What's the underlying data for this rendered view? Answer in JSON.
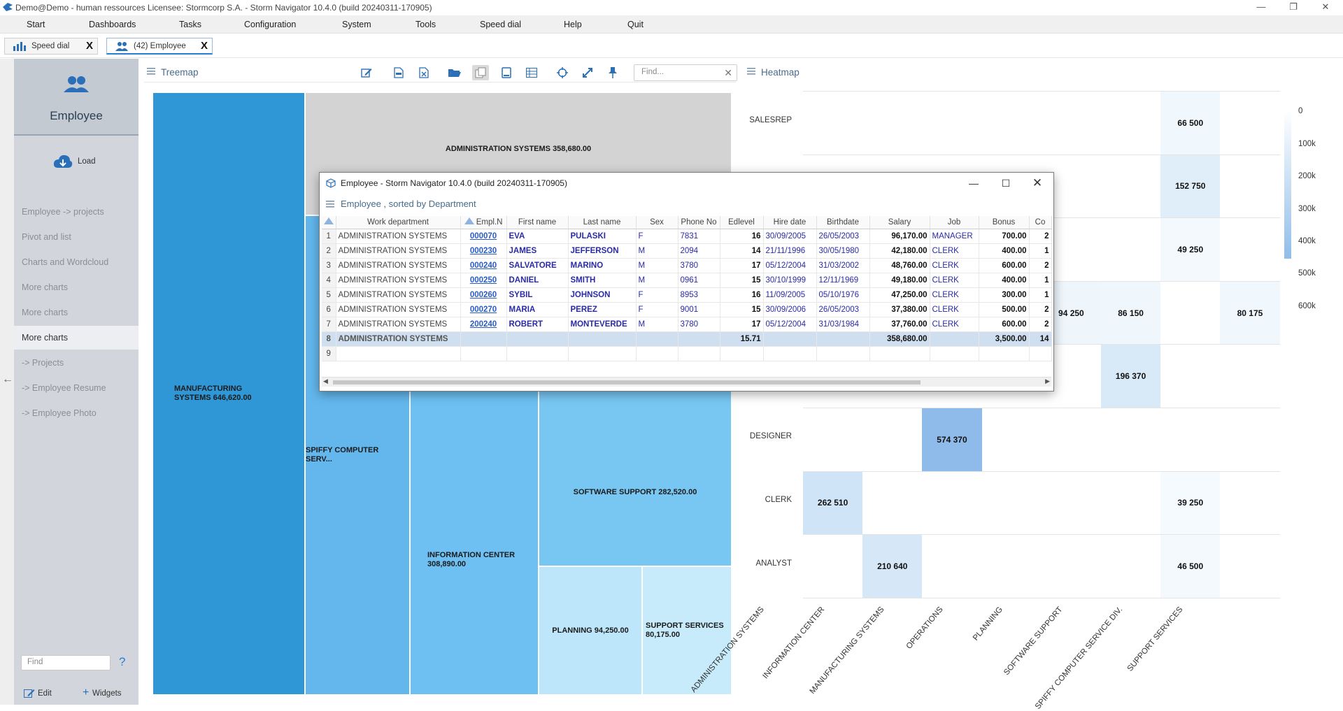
{
  "window": {
    "title": "Demo@Demo - human ressources   Licensee: Stormcorp S.A. -  Storm Navigator 10.4.0 (build 20240311-170905)",
    "controls": [
      "—",
      "❐",
      "✕"
    ]
  },
  "menu": [
    "Start",
    "Dashboards",
    "Tasks",
    "Configuration",
    "System",
    "Tools",
    "Speed dial",
    "Help",
    "Quit"
  ],
  "tabs": [
    {
      "label": "Speed dial",
      "close": "X"
    },
    {
      "label": "(42) Employee",
      "close": "X"
    }
  ],
  "sidebar": {
    "title": "Employee",
    "load_label": "Load",
    "items": [
      "Employee -> projects",
      "Pivot and list",
      "Charts and Wordcloud",
      "More charts",
      "More charts",
      "More charts",
      "-> Projects",
      "-> Employee Resume",
      "-> Employee Photo"
    ],
    "active_index": 5,
    "find_placeholder": "Find",
    "help": "?",
    "edit_label": "Edit",
    "widgets_label": "Widgets"
  },
  "treemap": {
    "title": "Treemap",
    "find_placeholder": "Find...",
    "clear": "✕",
    "cells": [
      {
        "label": "MANUFACTURING SYSTEMS 646,620.00",
        "value": 646620,
        "color": "#3097d6"
      },
      {
        "label": "ADMINISTRATION SYSTEMS 358,680.00",
        "value": 358680,
        "color": "#d3d3d3"
      },
      {
        "label": "SPIFFY COMPUTER SERV...",
        "value": null,
        "color": "#63b7ed"
      },
      {
        "label": "INFORMATION CENTER 308,890.00",
        "value": 308890,
        "color": "#6dc0f1"
      },
      {
        "label": "SOFTWARE SUPPORT 282,520.00",
        "value": 282520,
        "color": "#78c7f3"
      },
      {
        "label": "PLANNING 94,250.00",
        "value": 94250,
        "color": "#bde6fa"
      },
      {
        "label": "SUPPORT SERVICES 80,175.00",
        "value": 80175,
        "color": "#c7ebfb"
      }
    ]
  },
  "heatmap": {
    "title": "Heatmap",
    "rows": [
      "SALESREP",
      "",
      "",
      "",
      "",
      "DESIGNER",
      "CLERK",
      "ANALYST"
    ],
    "columns": [
      "ADMINISTRATION SYSTEMS",
      "INFORMATION CENTER",
      "MANUFACTURING SYSTEMS",
      "OPERATIONS",
      "PLANNING",
      "SOFTWARE SUPPORT",
      "SPIFFY COMPUTER SERVICE DIV.",
      "SUPPORT SERVICES"
    ],
    "cells": [
      {
        "row": 0,
        "col": 6,
        "value": "66 500",
        "color": "#f1f8fd"
      },
      {
        "row": 1,
        "col": 6,
        "value": "152 750",
        "color": "#e0eefa"
      },
      {
        "row": 2,
        "col": 6,
        "value": "49 250",
        "color": "#f4f9fe"
      },
      {
        "row": 3,
        "col": 4,
        "value": "94 250",
        "color": "#eef6fc"
      },
      {
        "row": 3,
        "col": 5,
        "value": "86 150",
        "color": "#eff6fc"
      },
      {
        "row": 3,
        "col": 7,
        "value": "80 175",
        "color": "#f0f7fd"
      },
      {
        "row": 4,
        "col": 5,
        "value": "196 370",
        "color": "#d8e9f8"
      },
      {
        "row": 5,
        "col": 2,
        "value": "574 370",
        "color": "#8ebbe9"
      },
      {
        "row": 6,
        "col": 0,
        "value": "262 510",
        "color": "#cfe4f6"
      },
      {
        "row": 6,
        "col": 6,
        "value": "39 250",
        "color": "#f5fafe"
      },
      {
        "row": 7,
        "col": 1,
        "value": "210 640",
        "color": "#d6e8f8"
      },
      {
        "row": 7,
        "col": 6,
        "value": "46 500",
        "color": "#f4f9fe"
      }
    ],
    "legend": [
      "0",
      "100k",
      "200k",
      "300k",
      "400k",
      "500k",
      "600k"
    ]
  },
  "dialog": {
    "title": "Employee -  Storm Navigator 10.4.0 (build 20240311-170905)",
    "controls": [
      "—",
      "☐",
      "✕"
    ],
    "subtitle": "Employee , sorted by Department",
    "columns": [
      "",
      "Work department",
      "Empl.N",
      "First name",
      "Last name",
      "Sex",
      "Phone No",
      "Edlevel",
      "Hire date",
      "Birthdate",
      "Salary",
      "Job",
      "Bonus",
      "Co"
    ],
    "rows": [
      [
        "1",
        "ADMINISTRATION SYSTEMS",
        "000070",
        "EVA",
        "PULASKI",
        "F",
        "7831",
        "16",
        "30/09/2005",
        "26/05/2003",
        "96,170.00",
        "MANAGER",
        "700.00",
        "2"
      ],
      [
        "2",
        "ADMINISTRATION SYSTEMS",
        "000230",
        "JAMES",
        "JEFFERSON",
        "M",
        "2094",
        "14",
        "21/11/1996",
        "30/05/1980",
        "42,180.00",
        "CLERK",
        "400.00",
        "1"
      ],
      [
        "3",
        "ADMINISTRATION SYSTEMS",
        "000240",
        "SALVATORE",
        "MARINO",
        "M",
        "3780",
        "17",
        "05/12/2004",
        "31/03/2002",
        "48,760.00",
        "CLERK",
        "600.00",
        "2"
      ],
      [
        "4",
        "ADMINISTRATION SYSTEMS",
        "000250",
        "DANIEL",
        "SMITH",
        "M",
        "0961",
        "15",
        "30/10/1999",
        "12/11/1969",
        "49,180.00",
        "CLERK",
        "400.00",
        "1"
      ],
      [
        "5",
        "ADMINISTRATION SYSTEMS",
        "000260",
        "SYBIL",
        "JOHNSON",
        "F",
        "8953",
        "16",
        "11/09/2005",
        "05/10/1976",
        "47,250.00",
        "CLERK",
        "300.00",
        "1"
      ],
      [
        "6",
        "ADMINISTRATION SYSTEMS",
        "000270",
        "MARIA",
        "PEREZ",
        "F",
        "9001",
        "15",
        "30/09/2006",
        "26/05/2003",
        "37,380.00",
        "CLERK",
        "500.00",
        "2"
      ],
      [
        "7",
        "ADMINISTRATION SYSTEMS",
        "200240",
        "ROBERT",
        "MONTEVERDE",
        "M",
        "3780",
        "17",
        "05/12/2004",
        "31/03/1984",
        "37,760.00",
        "CLERK",
        "600.00",
        "2"
      ]
    ],
    "total_row": [
      "8",
      "ADMINISTRATION SYSTEMS",
      "",
      "",
      "",
      "",
      "",
      "15.71",
      "",
      "",
      "358,680.00",
      "",
      "3,500.00",
      "14"
    ],
    "empty_row": [
      "9"
    ]
  }
}
